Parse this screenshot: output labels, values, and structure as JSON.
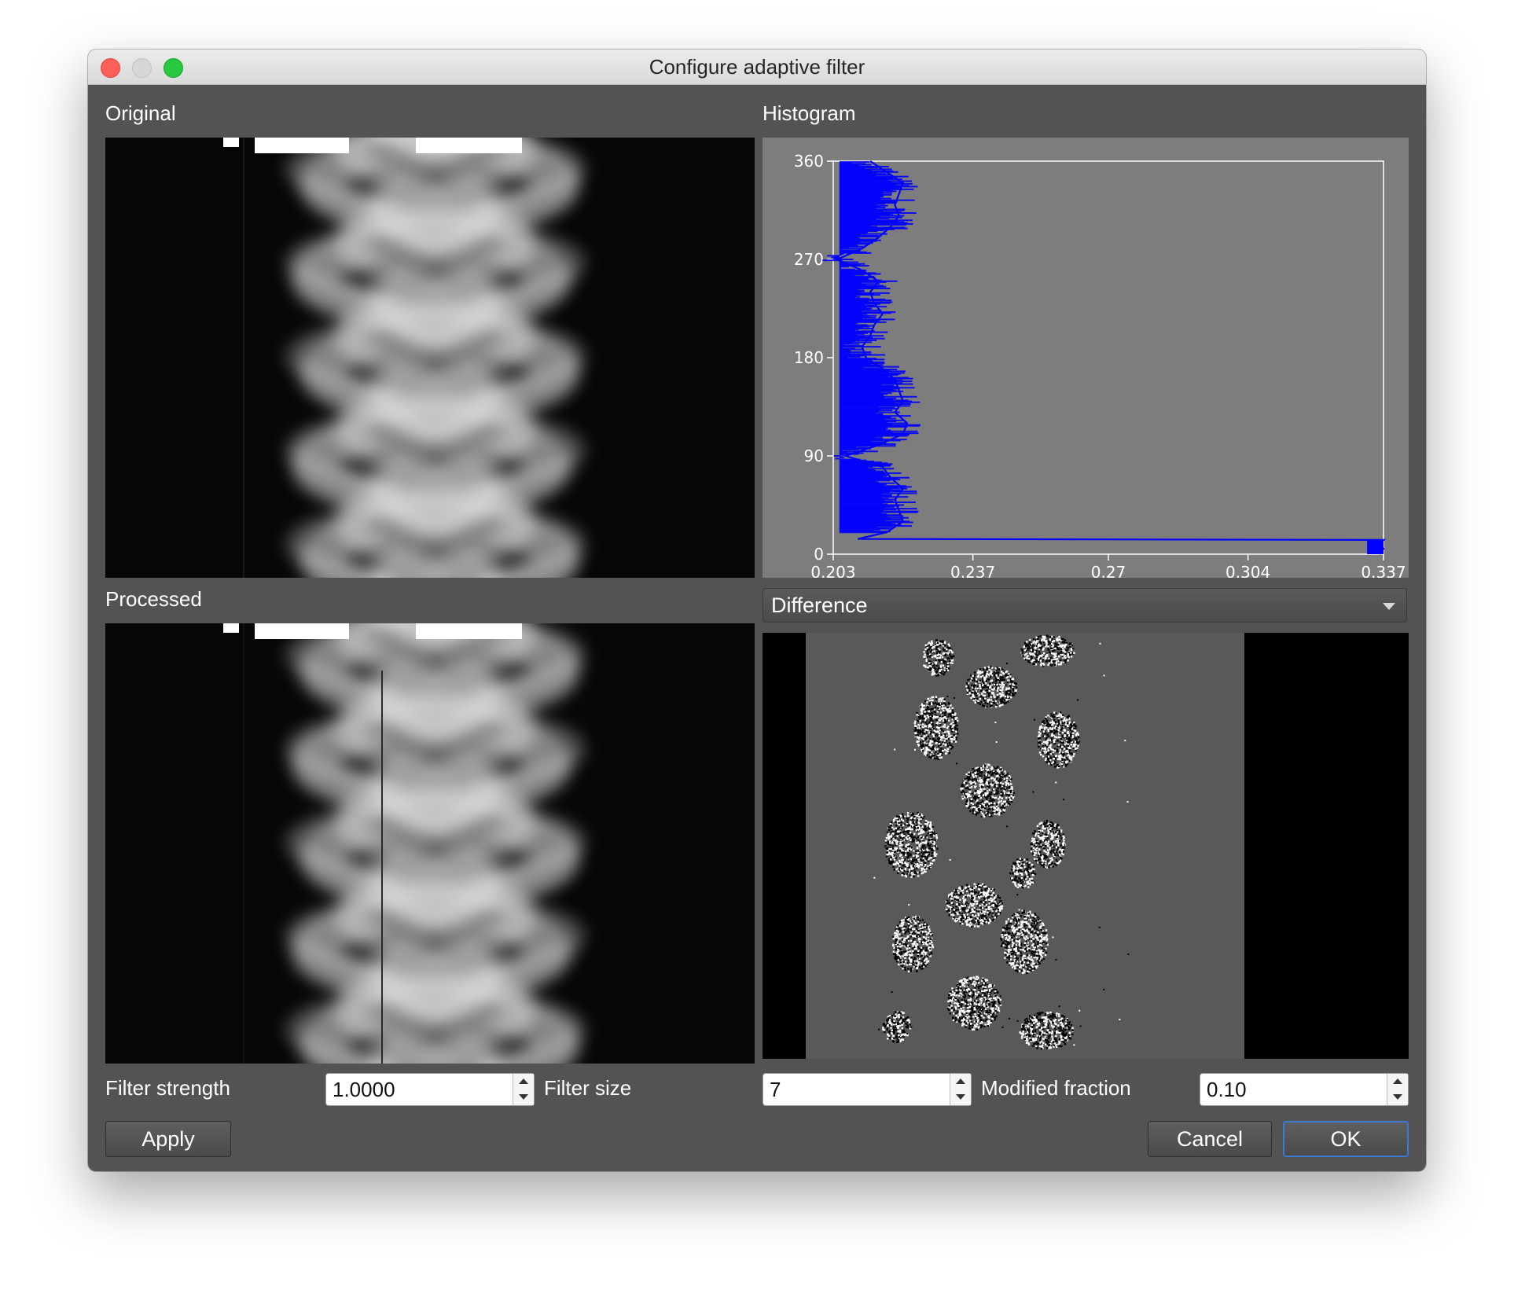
{
  "window": {
    "title": "Configure adaptive filter"
  },
  "panels": {
    "original_label": "Original",
    "processed_label": "Processed",
    "histogram_label": "Histogram"
  },
  "histogram": {
    "type": "line",
    "orientation": "horizontal-bins",
    "series_color": "#0000ff",
    "x_ticks": [
      "0.203",
      "0.237",
      "0.27",
      "0.304",
      "0.337"
    ],
    "y_ticks": [
      "0",
      "90",
      "180",
      "270",
      "360"
    ],
    "xlim": [
      0.203,
      0.337
    ],
    "ylim": [
      0,
      360
    ]
  },
  "chart_data": {
    "type": "line",
    "x_ticks": [
      "0.203",
      "0.237",
      "0.27",
      "0.304",
      "0.337"
    ],
    "y_ticks": [
      "0",
      "90",
      "180",
      "270",
      "360"
    ],
    "xlim": [
      0.203,
      0.337
    ],
    "ylim": [
      0,
      360
    ],
    "series": [
      {
        "color": "#0000ff",
        "points": [
          {
            "y": 0,
            "x": 0.336
          },
          {
            "y": 5,
            "x": 0.337
          },
          {
            "y": 10,
            "x": 0.336
          },
          {
            "y": 13,
            "x": 0.337
          },
          {
            "y": 14,
            "x": 0.209
          },
          {
            "y": 20,
            "x": 0.216
          },
          {
            "y": 30,
            "x": 0.22
          },
          {
            "y": 40,
            "x": 0.219
          },
          {
            "y": 50,
            "x": 0.218
          },
          {
            "y": 60,
            "x": 0.22
          },
          {
            "y": 70,
            "x": 0.217
          },
          {
            "y": 80,
            "x": 0.215
          },
          {
            "y": 90,
            "x": 0.206
          },
          {
            "y": 100,
            "x": 0.214
          },
          {
            "y": 110,
            "x": 0.22
          },
          {
            "y": 120,
            "x": 0.221
          },
          {
            "y": 130,
            "x": 0.218
          },
          {
            "y": 140,
            "x": 0.22
          },
          {
            "y": 150,
            "x": 0.219
          },
          {
            "y": 160,
            "x": 0.218
          },
          {
            "y": 170,
            "x": 0.215
          },
          {
            "y": 180,
            "x": 0.211
          },
          {
            "y": 190,
            "x": 0.21
          },
          {
            "y": 200,
            "x": 0.212
          },
          {
            "y": 210,
            "x": 0.213
          },
          {
            "y": 220,
            "x": 0.215
          },
          {
            "y": 230,
            "x": 0.213
          },
          {
            "y": 240,
            "x": 0.212
          },
          {
            "y": 250,
            "x": 0.214
          },
          {
            "y": 260,
            "x": 0.21
          },
          {
            "y": 270,
            "x": 0.204
          },
          {
            "y": 280,
            "x": 0.21
          },
          {
            "y": 290,
            "x": 0.214
          },
          {
            "y": 300,
            "x": 0.217
          },
          {
            "y": 310,
            "x": 0.219
          },
          {
            "y": 320,
            "x": 0.218
          },
          {
            "y": 330,
            "x": 0.219
          },
          {
            "y": 340,
            "x": 0.22
          },
          {
            "y": 350,
            "x": 0.216
          },
          {
            "y": 360,
            "x": 0.212
          }
        ]
      }
    ]
  },
  "view_select": {
    "selected": "Difference"
  },
  "controls": {
    "filter_strength_label": "Filter strength",
    "filter_strength_value": "1.0000",
    "filter_size_label": "Filter size",
    "filter_size_value": "7",
    "modified_fraction_label": "Modified fraction",
    "modified_fraction_value": "0.10"
  },
  "buttons": {
    "apply": "Apply",
    "cancel": "Cancel",
    "ok": "OK"
  }
}
